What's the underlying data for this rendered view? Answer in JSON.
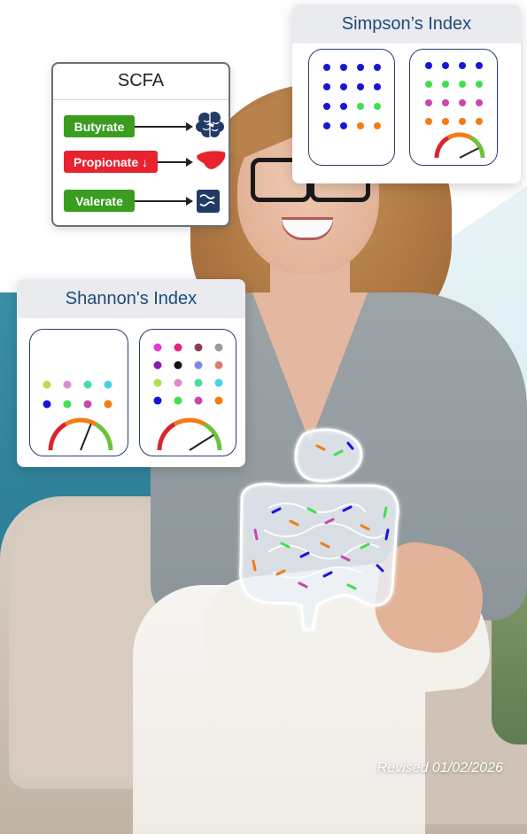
{
  "scfa": {
    "title": "SCFA",
    "items": [
      {
        "label": "Butyrate",
        "color": "#3a9d1f",
        "icon": "brain-icon"
      },
      {
        "label": "Propionate ↓",
        "color": "#e8222e",
        "icon": "liver-icon"
      },
      {
        "label": "Valerate",
        "color": "#3a9d1f",
        "icon": "intestine-icon"
      }
    ]
  },
  "simpson": {
    "title": "Simpson’s Index",
    "left_dots": [
      [
        "#1a14d9",
        "#1a14d9",
        "#1a14d9",
        "#1a14d9"
      ],
      [
        "#1a14d9",
        "#1a14d9",
        "#1a14d9",
        "#1a14d9"
      ],
      [
        "#1a14d9",
        "#1a14d9",
        "#3fe04f",
        "#3fe04f"
      ],
      [
        "#1a14d9",
        "#1a14d9",
        "#f27c16",
        "#f27c16"
      ]
    ],
    "right_dots": [
      [
        "#1a14d9",
        "#1a14d9",
        "#1a14d9",
        "#1a14d9"
      ],
      [
        "#3fe04f",
        "#3fe04f",
        "#3fe04f",
        "#3fe04f"
      ],
      [
        "#c548b0",
        "#c548b0",
        "#c548b0",
        "#c548b0"
      ],
      [
        "#f27c16",
        "#f27c16",
        "#f27c16",
        "#f27c16"
      ]
    ],
    "right_gauge_level": 0.85
  },
  "shannon": {
    "title": "Shannon's Index",
    "left_dots": [
      [
        "#b4e04a",
        "#e08ad0",
        "#44e0a0",
        "#4ad0e8"
      ],
      [
        "#1a14d9",
        "#3fe04f",
        "#c548b0",
        "#f27c16"
      ]
    ],
    "left_gauge_level": 0.62,
    "right_dots": [
      [
        "#e238d8",
        "#e8227a",
        "#8a3a5a",
        "#9a9a9a"
      ],
      [
        "#8a1ab8",
        "#111111",
        "#7a8ae8",
        "#d8806a"
      ],
      [
        "#b4e04a",
        "#e08ad0",
        "#44e0a0",
        "#4ad0e8"
      ],
      [
        "#1a14d9",
        "#3fe04f",
        "#c548b0",
        "#f27c16"
      ]
    ],
    "right_gauge_level": 0.82
  },
  "footer": {
    "revised": "Revised 01/02/2026"
  }
}
